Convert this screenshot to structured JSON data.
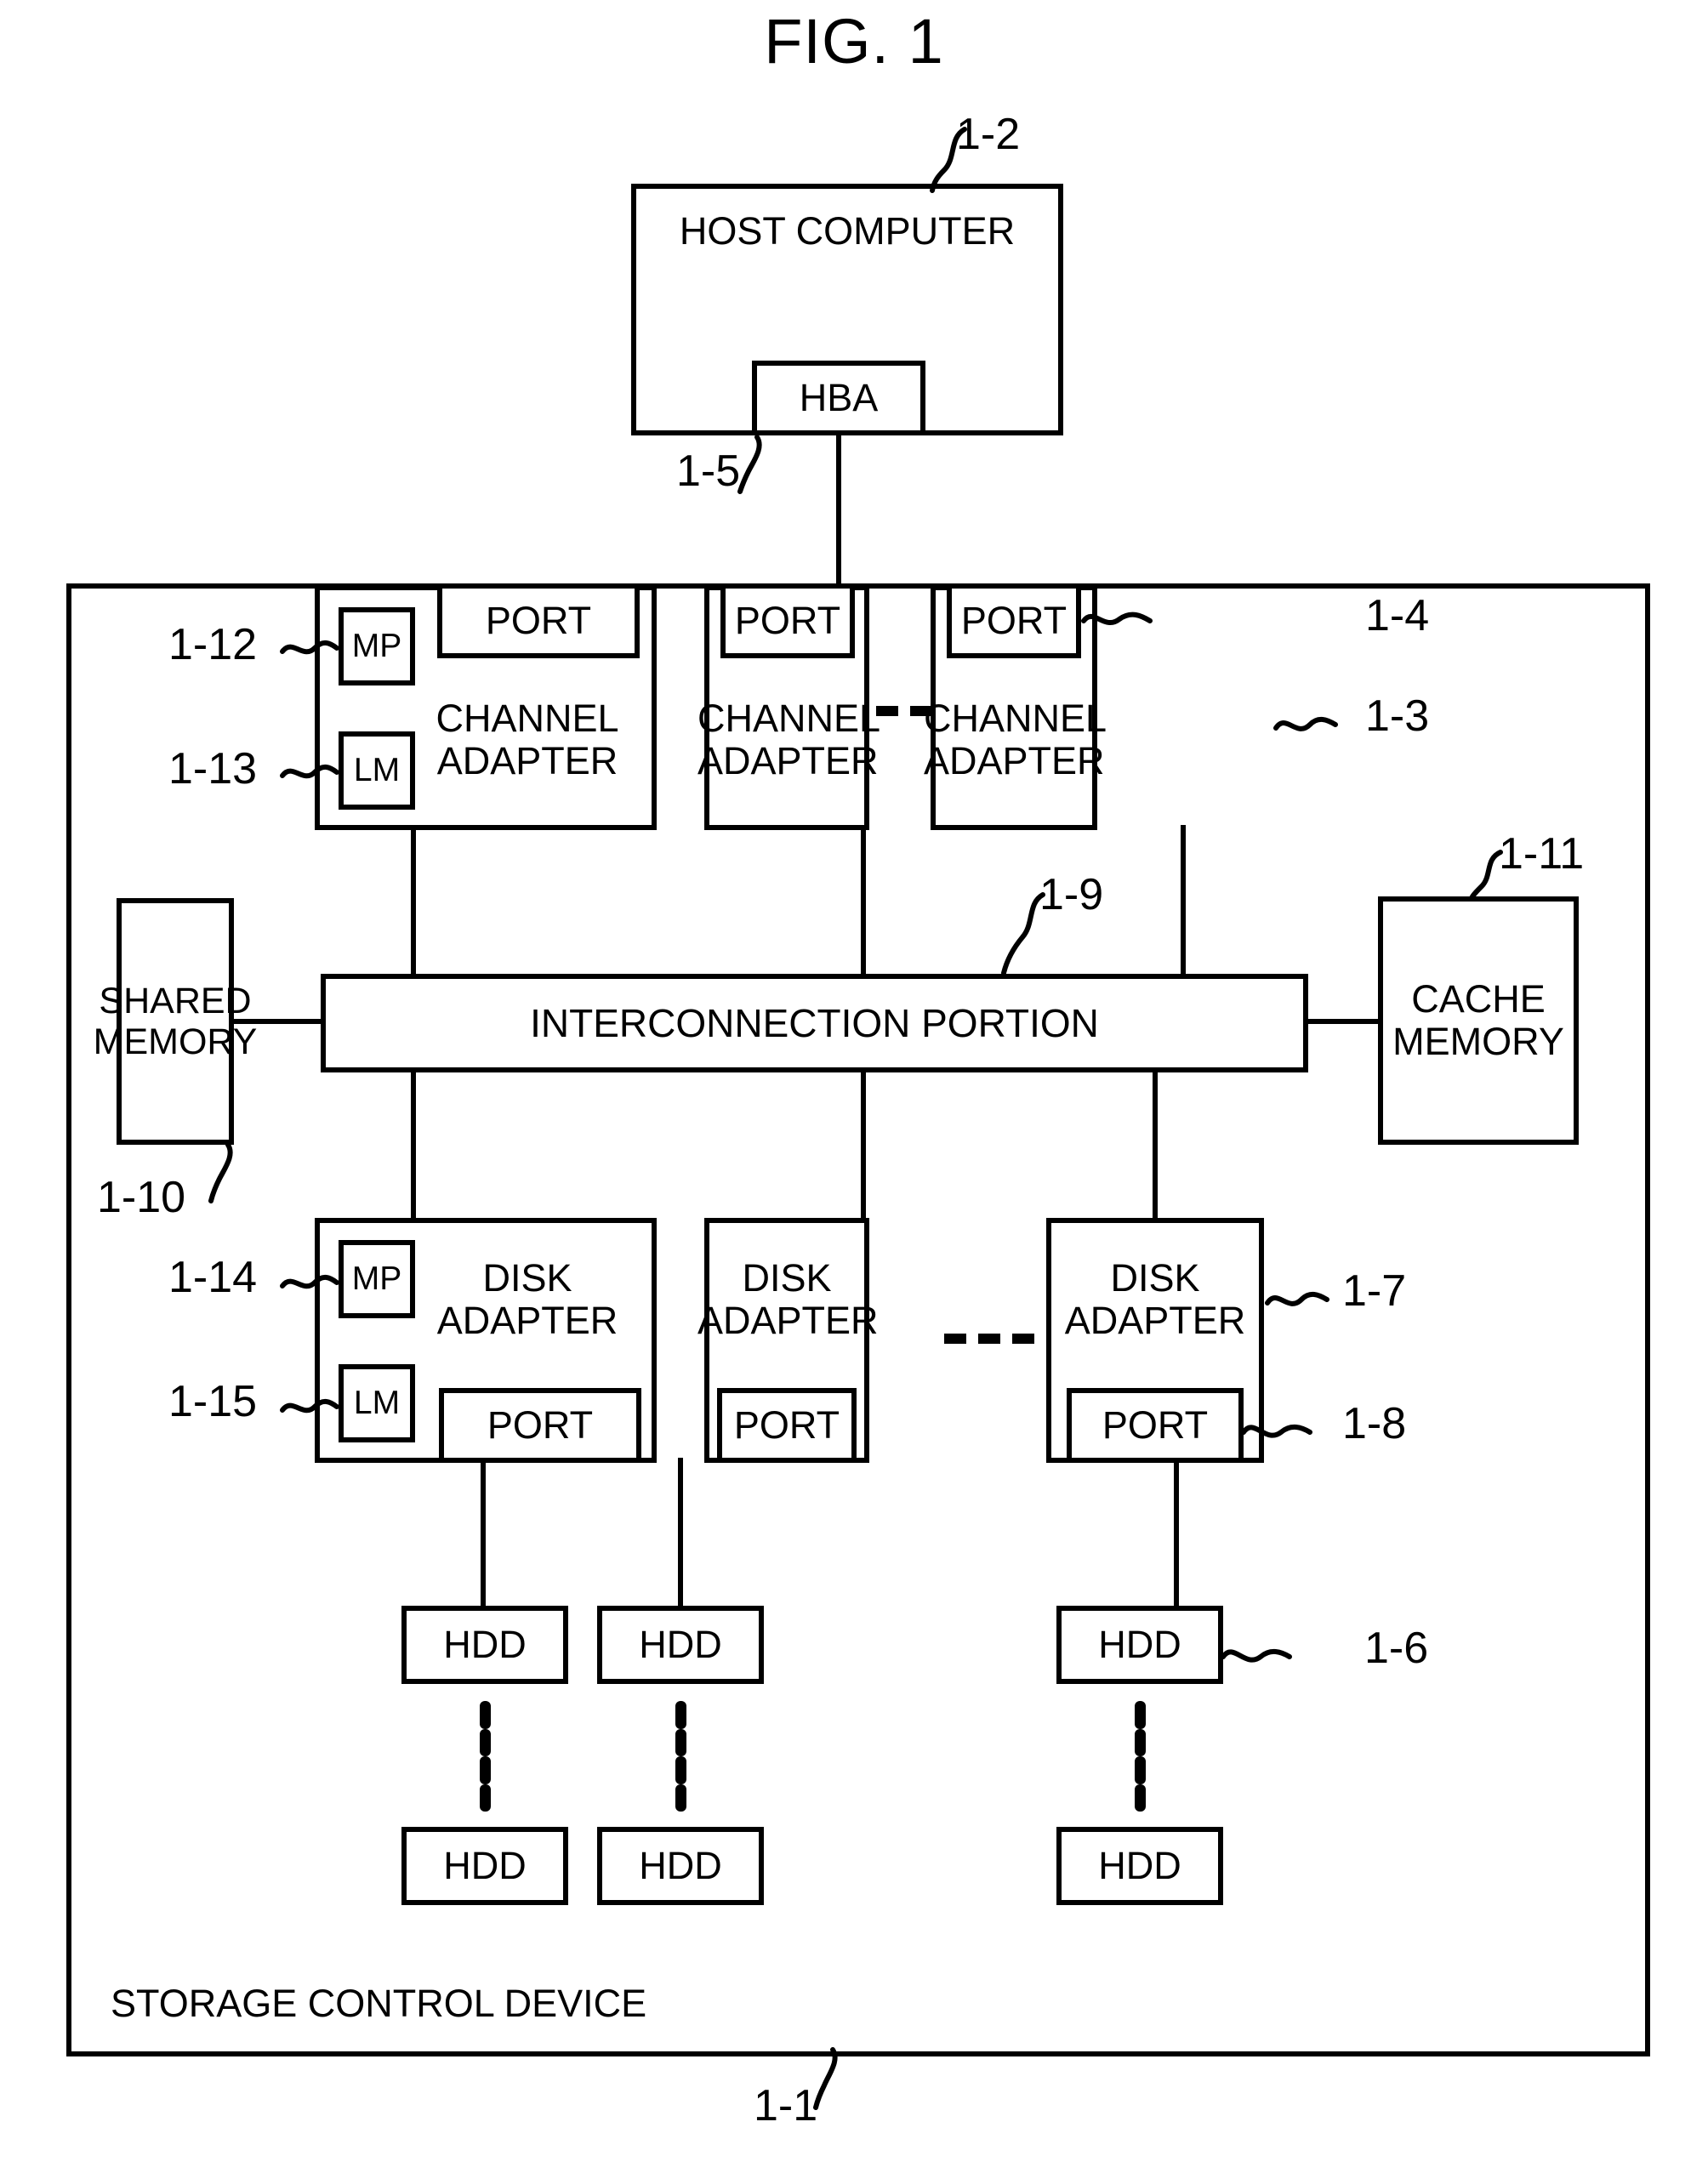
{
  "figure": {
    "title": "FIG. 1",
    "type": "block-diagram",
    "caption": "Storage control device block diagram"
  },
  "host": {
    "label": "HOST COMPUTER",
    "ref": "1-2",
    "hba": {
      "label": "HBA",
      "ref": "1-5"
    }
  },
  "storage_device": {
    "label": "STORAGE CONTROL DEVICE",
    "ref": "1-1"
  },
  "channel_adapters": {
    "ref": "1-3",
    "port_ref": "1-4",
    "mp_ref": "1-12",
    "lm_ref": "1-13",
    "port_label": "PORT",
    "mp_label": "MP",
    "lm_label": "LM",
    "items": [
      {
        "label_line1": "CHANNEL",
        "label_line2": "ADAPTER"
      },
      {
        "label_line1": "CHANNEL",
        "label_line2": "ADAPTER"
      },
      {
        "label_line1": "CHANNEL",
        "label_line2": "ADAPTER"
      }
    ],
    "ellipsis": "- - -"
  },
  "interconnection": {
    "label": "INTERCONNECTION PORTION",
    "ref": "1-9"
  },
  "shared_memory": {
    "label_line1": "SHARED",
    "label_line2": "MEMORY",
    "ref": "1-10"
  },
  "cache_memory": {
    "label_line1": "CACHE",
    "label_line2": "MEMORY",
    "ref": "1-11"
  },
  "disk_adapters": {
    "ref": "1-7",
    "port_ref": "1-8",
    "mp_ref": "1-14",
    "lm_ref": "1-15",
    "port_label": "PORT",
    "mp_label": "MP",
    "lm_label": "LM",
    "items": [
      {
        "label_line1": "DISK",
        "label_line2": "ADAPTER"
      },
      {
        "label_line1": "DISK",
        "label_line2": "ADAPTER"
      },
      {
        "label_line1": "DISK",
        "label_line2": "ADAPTER"
      }
    ],
    "ellipsis": "- - -"
  },
  "hdds": {
    "label": "HDD",
    "ref": "1-6",
    "columns": [
      {
        "top": "HDD",
        "bottom": "HDD"
      },
      {
        "top": "HDD",
        "bottom": "HDD"
      },
      {
        "top": "HDD",
        "bottom": "HDD"
      }
    ]
  },
  "colors": {
    "stroke": "#000000",
    "background": "#ffffff"
  }
}
